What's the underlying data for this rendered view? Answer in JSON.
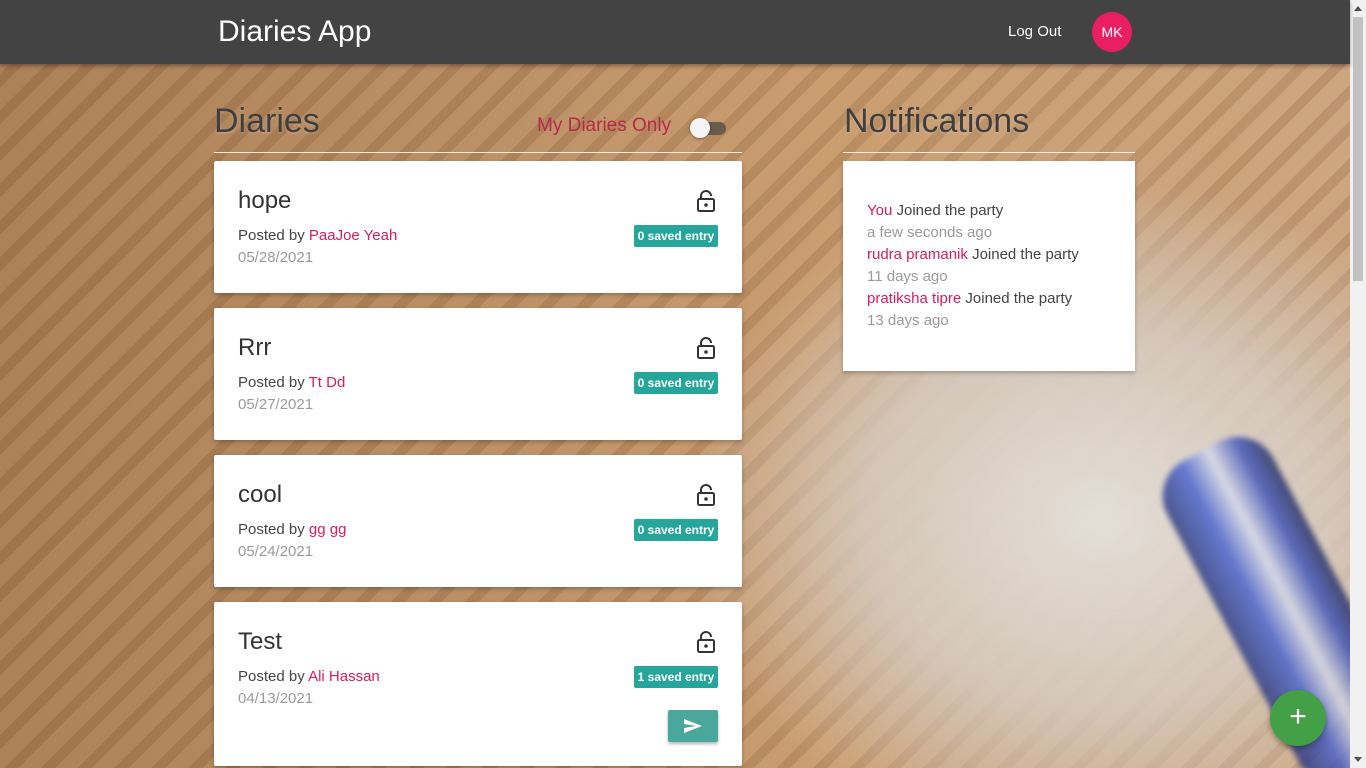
{
  "app": {
    "title": "Diaries App",
    "logout_label": "Log Out",
    "avatar_initials": "MK"
  },
  "diaries": {
    "heading": "Diaries",
    "toggle_label": "My Diaries Only",
    "toggle_on": false,
    "posted_by_label": "Posted by",
    "items": [
      {
        "title": "hope",
        "author": "PaaJoe Yeah",
        "date": "05/28/2021",
        "badge": "0 saved entry",
        "icon": "lock-open-icon"
      },
      {
        "title": "Rrr",
        "author": "Tt Dd",
        "date": "05/27/2021",
        "badge": "0 saved entry",
        "icon": "lock-open-icon"
      },
      {
        "title": "cool",
        "author": "gg gg",
        "date": "05/24/2021",
        "badge": "0 saved entry",
        "icon": "lock-open-icon"
      },
      {
        "title": "Test",
        "author": "Ali Hassan",
        "date": "04/13/2021",
        "badge": "1 saved entry",
        "icon": "lock-open-icon",
        "action_icon": "send-icon"
      }
    ]
  },
  "notifications": {
    "heading": "Notifications",
    "items": [
      {
        "user": "You",
        "text": "Joined the party",
        "time": "a few seconds ago"
      },
      {
        "user": "rudra pramanik",
        "text": "Joined the party",
        "time": "11 days ago"
      },
      {
        "user": "pratiksha tipre",
        "text": "Joined the party",
        "time": "13 days ago"
      }
    ]
  },
  "fab": {
    "icon": "plus-icon",
    "label": "+"
  },
  "colors": {
    "navbar": "#434343",
    "accent": "#d81b60",
    "badge": "#26a69a",
    "fab": "#43a047",
    "avatar": "#e91e63"
  }
}
